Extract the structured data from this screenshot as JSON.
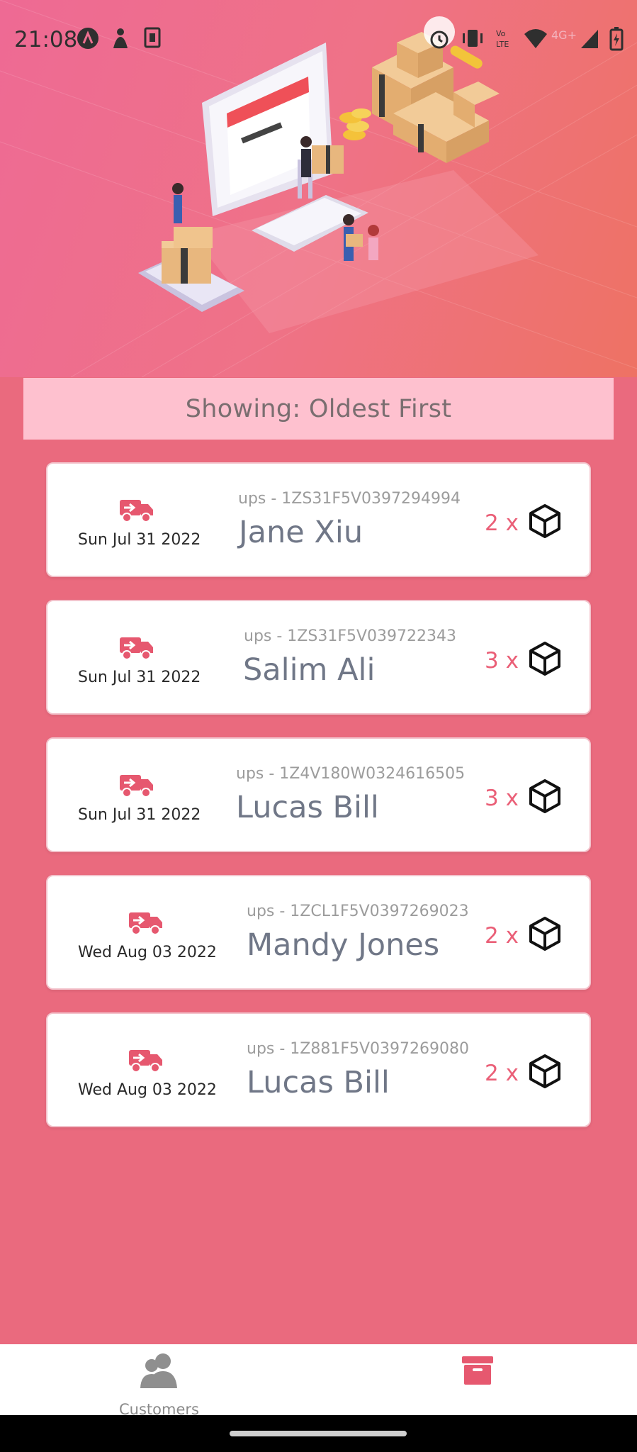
{
  "status_bar": {
    "time": "21:08",
    "network": "4G+"
  },
  "hero": {
    "illustration": "ecommerce-warehouse-illustration"
  },
  "sort_banner": {
    "text": "Showing: Oldest First"
  },
  "shipments": [
    {
      "date": "Sun Jul 31 2022",
      "tracking": "ups - 1ZS31F5V0397294994",
      "customer": "Jane Xiu",
      "quantity": "2 x"
    },
    {
      "date": "Sun Jul 31 2022",
      "tracking": "ups - 1ZS31F5V039722343",
      "customer": "Salim Ali",
      "quantity": "3 x"
    },
    {
      "date": "Sun Jul 31 2022",
      "tracking": "ups - 1Z4V180W0324616505",
      "customer": "Lucas Bill",
      "quantity": "3 x"
    },
    {
      "date": "Wed Aug 03 2022",
      "tracking": "ups - 1ZCL1F5V0397269023",
      "customer": "Mandy Jones",
      "quantity": "2 x"
    },
    {
      "date": "Wed Aug 03 2022",
      "tracking": "ups - 1Z881F5V0397269080",
      "customer": "Lucas Bill",
      "quantity": "2 x"
    }
  ],
  "bottom_nav": {
    "customers_label": "Customers",
    "archive_icon": "archive-icon"
  },
  "colors": {
    "background": "#ea6a7e",
    "accent": "#ea5f77",
    "banner": "#fec1cf"
  }
}
